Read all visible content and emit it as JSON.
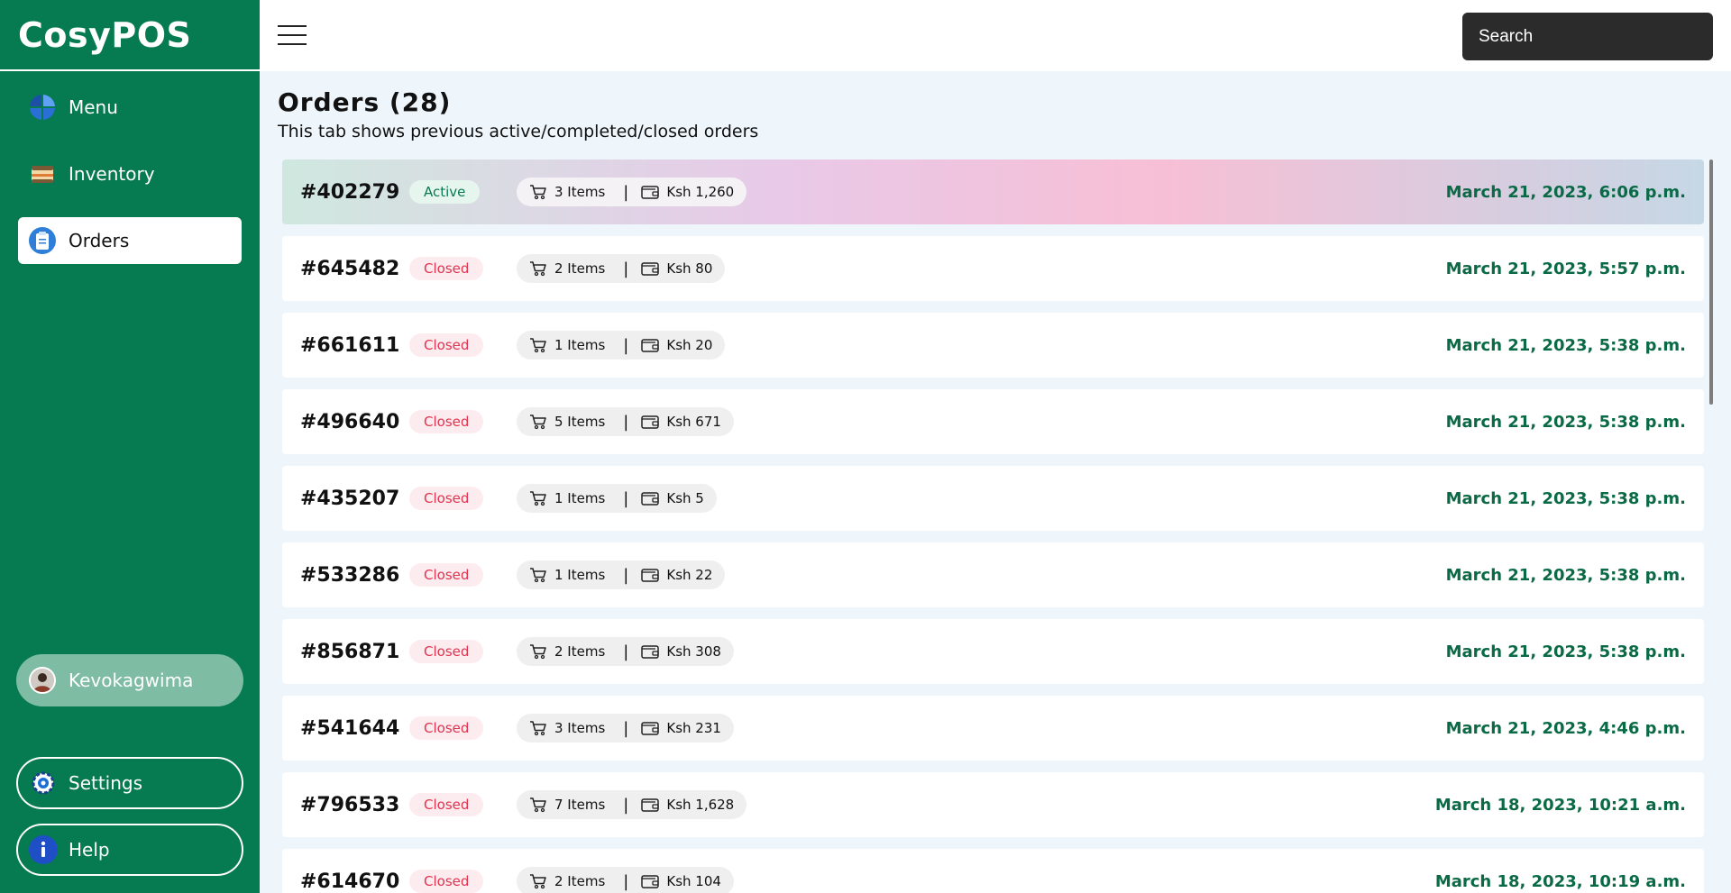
{
  "app": {
    "brand": "CosyPOS"
  },
  "sidebar": {
    "items": [
      {
        "label": "Menu",
        "icon": "pie-chart-icon",
        "active": false
      },
      {
        "label": "Inventory",
        "icon": "inventory-icon",
        "active": false
      },
      {
        "label": "Orders",
        "icon": "clipboard-icon",
        "active": true
      }
    ],
    "user": {
      "name": "Kevokagwima"
    },
    "settings_label": "Settings",
    "help_label": "Help"
  },
  "header": {
    "search_placeholder": "Search"
  },
  "page": {
    "title": "Orders (28)",
    "subtitle": "This tab shows previous active/completed/closed orders"
  },
  "orders": [
    {
      "id": "#402279",
      "status": "Active",
      "items": "3 Items",
      "total": "Ksh 1,260",
      "date": "March 21, 2023, 6:06 p.m."
    },
    {
      "id": "#645482",
      "status": "Closed",
      "items": "2 Items",
      "total": "Ksh 80",
      "date": "March 21, 2023, 5:57 p.m."
    },
    {
      "id": "#661611",
      "status": "Closed",
      "items": "1 Items",
      "total": "Ksh 20",
      "date": "March 21, 2023, 5:38 p.m."
    },
    {
      "id": "#496640",
      "status": "Closed",
      "items": "5 Items",
      "total": "Ksh 671",
      "date": "March 21, 2023, 5:38 p.m."
    },
    {
      "id": "#435207",
      "status": "Closed",
      "items": "1 Items",
      "total": "Ksh 5",
      "date": "March 21, 2023, 5:38 p.m."
    },
    {
      "id": "#533286",
      "status": "Closed",
      "items": "1 Items",
      "total": "Ksh 22",
      "date": "March 21, 2023, 5:38 p.m."
    },
    {
      "id": "#856871",
      "status": "Closed",
      "items": "2 Items",
      "total": "Ksh 308",
      "date": "March 21, 2023, 5:38 p.m."
    },
    {
      "id": "#541644",
      "status": "Closed",
      "items": "3 Items",
      "total": "Ksh 231",
      "date": "March 21, 2023, 4:46 p.m."
    },
    {
      "id": "#796533",
      "status": "Closed",
      "items": "7 Items",
      "total": "Ksh 1,628",
      "date": "March 18, 2023, 10:21 a.m."
    },
    {
      "id": "#614670",
      "status": "Closed",
      "items": "2 Items",
      "total": "Ksh 104",
      "date": "March 18, 2023, 10:19 a.m."
    }
  ],
  "colors": {
    "sidebar_bg": "#067a50",
    "active_status": "#0a7a4f",
    "closed_status": "#e2334f",
    "date_text": "#0a6a46"
  }
}
